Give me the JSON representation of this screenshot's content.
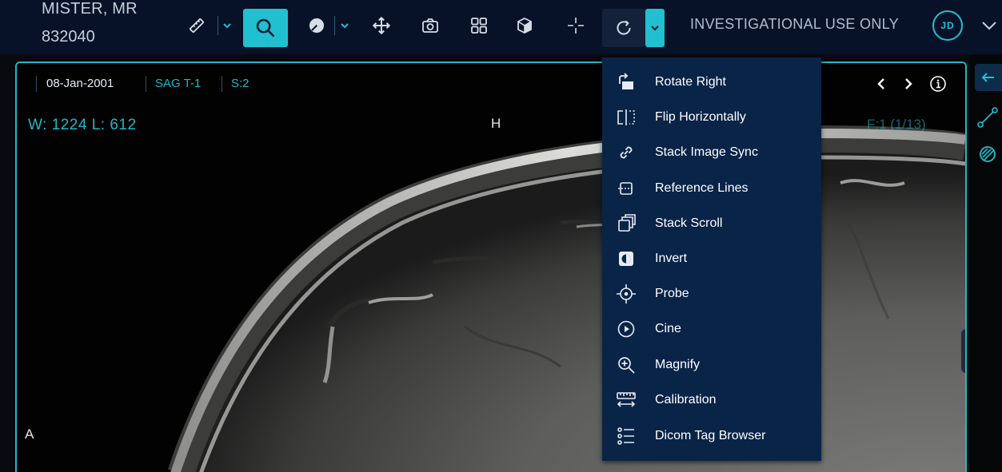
{
  "patient": {
    "name": "MISTER, MR",
    "id": "832040"
  },
  "toolbar": {
    "tools": [
      {
        "icon": "ruler-icon",
        "active": false
      },
      {
        "icon": "search-zoom-icon",
        "active": true
      },
      {
        "icon": "contrast-icon",
        "active": false
      },
      {
        "icon": "move-arrows-icon",
        "active": false
      },
      {
        "icon": "camera-icon",
        "active": false
      },
      {
        "icon": "layout-grid-icon",
        "active": false
      },
      {
        "icon": "cube-3d-icon",
        "active": false
      },
      {
        "icon": "crosshair-icon",
        "active": false
      },
      {
        "icon": "rotate-icon",
        "active": false
      }
    ],
    "investigational_label": "INVESTIGATIONAL USE ONLY",
    "user_initials": "JD",
    "accent_color": "#20c0d0"
  },
  "viewport": {
    "study_date": "08-Jan-2001",
    "series": "SAG T-1",
    "slice": "S:2",
    "window_level": "W: 1224  L: 612",
    "orientation_top": "H",
    "orientation_left": "A",
    "frame": "F:1 (1/13)",
    "border_color": "#1fb8c8"
  },
  "menu": {
    "items": [
      {
        "label": "Rotate Right",
        "icon": "rotate-right-icon"
      },
      {
        "label": "Flip Horizontally",
        "icon": "flip-horizontal-icon"
      },
      {
        "label": "Stack Image Sync",
        "icon": "link-icon"
      },
      {
        "label": "Reference Lines",
        "icon": "reference-lines-icon"
      },
      {
        "label": "Stack Scroll",
        "icon": "stack-scroll-icon"
      },
      {
        "label": "Invert",
        "icon": "invert-icon"
      },
      {
        "label": "Probe",
        "icon": "probe-icon"
      },
      {
        "label": "Cine",
        "icon": "cine-play-icon"
      },
      {
        "label": "Magnify",
        "icon": "magnify-icon"
      },
      {
        "label": "Calibration",
        "icon": "calibration-icon"
      },
      {
        "label": "Dicom Tag Browser",
        "icon": "tag-list-icon"
      }
    ],
    "background": "#0a2448"
  }
}
